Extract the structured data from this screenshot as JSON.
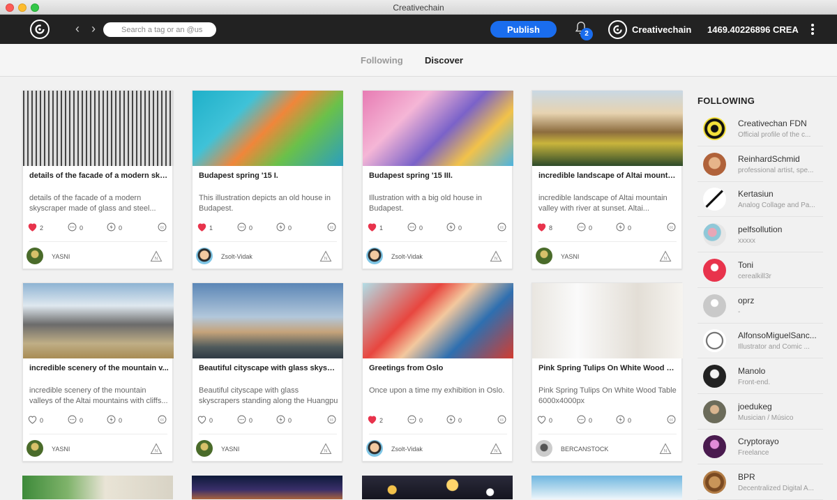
{
  "window": {
    "title": "Creativechain"
  },
  "nav": {
    "search_placeholder": "Search a tag or an @us",
    "back_forward": "‹ ›",
    "publish_label": "Publish",
    "notification_count": "2",
    "account_name": "Creativechain",
    "balance": "1469.40226896 CREA"
  },
  "tabs": {
    "following": "Following",
    "discover": "Discover"
  },
  "colors": {
    "accent": "#1a6dee",
    "topbar": "#222222",
    "like": "#e8334c"
  },
  "cards": [
    {
      "title": "details of the facade of a modern sky...",
      "desc": "details of the facade of a modern skyscraper made of glass and steel...",
      "likes": "2",
      "liked": true,
      "comments": "0",
      "tips": "0",
      "author": "YASNI"
    },
    {
      "title": "Budapest spring '15 I.",
      "desc": "This illustration depicts an old house in Budapest.",
      "likes": "1",
      "liked": true,
      "comments": "0",
      "tips": "0",
      "author": "Zsolt-Vidak"
    },
    {
      "title": "Budapest spring '15 III.",
      "desc": "Illustration with a big old house in Budapest.",
      "likes": "1",
      "liked": true,
      "comments": "0",
      "tips": "0",
      "author": "Zsolt-Vidak"
    },
    {
      "title": "incredible landscape of Altai mounta...",
      "desc": "incredible landscape of Altai mountain valley with river at sunset. Altai...",
      "likes": "8",
      "liked": true,
      "comments": "0",
      "tips": "0",
      "author": "YASNI"
    },
    {
      "title": "incredible scenery of the mountain v...",
      "desc": "incredible scenery of the mountain valleys of the Altai mountains with cliffs...",
      "likes": "0",
      "liked": false,
      "comments": "0",
      "tips": "0",
      "author": "YASNI"
    },
    {
      "title": "Beautiful cityscape with glass skyscr...",
      "desc": "Beautiful cityscape with glass skyscrapers standing along the Huangpu River...",
      "likes": "0",
      "liked": false,
      "comments": "0",
      "tips": "0",
      "author": "YASNI"
    },
    {
      "title": "Greetings from Oslo",
      "desc": "Once upon a time my exhibition in Oslo.",
      "likes": "2",
      "liked": true,
      "comments": "0",
      "tips": "0",
      "author": "Zsolt-Vidak"
    },
    {
      "title": "Pink Spring Tulips On White Wood Ta...",
      "desc": "Pink Spring Tulips On White Wood Table 6000x4000px",
      "likes": "0",
      "liked": false,
      "comments": "0",
      "tips": "0",
      "author": "BERCANSTOCK"
    }
  ],
  "following": {
    "header": "FOLLOWING",
    "items": [
      {
        "name": "Creativechan FDN",
        "desc": "Official profile of the c..."
      },
      {
        "name": "ReinhardSchmid",
        "desc": "professional artist, spe..."
      },
      {
        "name": "Kertasiun",
        "desc": "Analog Collage and Pa..."
      },
      {
        "name": "pelfsollution",
        "desc": "xxxxx"
      },
      {
        "name": "Toni",
        "desc": "cerealkill3r"
      },
      {
        "name": "oprz",
        "desc": "-"
      },
      {
        "name": "AlfonsoMiguelSanc...",
        "desc": "Illustrator and Comic ..."
      },
      {
        "name": "Manolo",
        "desc": "Front-end."
      },
      {
        "name": "joedukeg",
        "desc": "Musician / Músico"
      },
      {
        "name": "Cryptorayo",
        "desc": "Freelance"
      },
      {
        "name": "BPR",
        "desc": "Decentralized Digital A..."
      }
    ]
  }
}
